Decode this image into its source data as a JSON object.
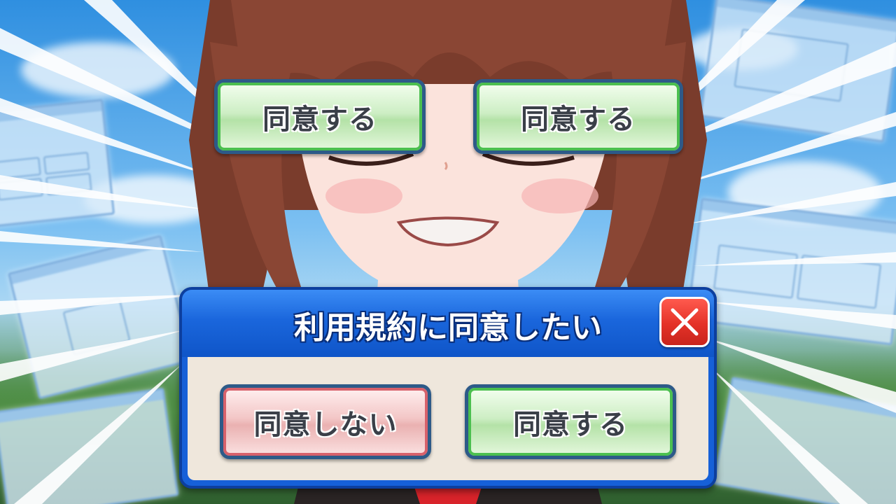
{
  "dialog": {
    "title": "利用規約に同意したい",
    "decline_label": "同意しない",
    "accept_label": "同意する"
  },
  "overlay_buttons": {
    "left_label": "同意する",
    "right_label": "同意する"
  },
  "icons": {
    "close": "close-icon"
  },
  "colors": {
    "dialog_blue": "#1660d8",
    "dialog_body": "#efe7dc",
    "accept_green": "#4bbf4f",
    "decline_red": "#d7616b",
    "close_red": "#e43228"
  }
}
